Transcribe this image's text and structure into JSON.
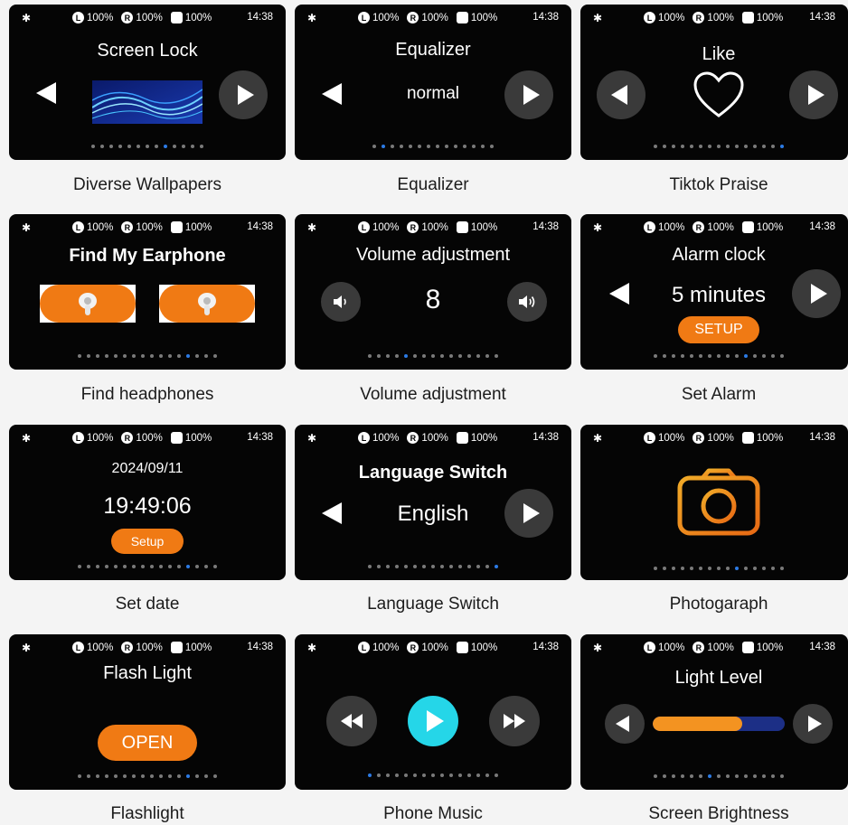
{
  "status_bar": {
    "left_pct": "100%",
    "right_pct": "100%",
    "battery_pct": "100%",
    "time": "14:38",
    "left_label": "L",
    "right_label": "R"
  },
  "cards": {
    "wallpapers": {
      "title": "Screen Lock",
      "caption": "Diverse Wallpapers"
    },
    "equalizer": {
      "title": "Equalizer",
      "value": "normal",
      "caption": "Equalizer"
    },
    "praise": {
      "title": "Like",
      "caption": "Tiktok Praise"
    },
    "find": {
      "title": "Find My Earphone",
      "caption": "Find headphones"
    },
    "volume": {
      "title": "Volume adjustment",
      "value": "8",
      "caption": "Volume adjustment"
    },
    "alarm": {
      "title": "Alarm clock",
      "value": "5 minutes",
      "button": "SETUP",
      "caption": "Set Alarm"
    },
    "date": {
      "date": "2024/09/11",
      "time": "19:49:06",
      "button": "Setup",
      "caption": "Set date"
    },
    "language": {
      "title": "Language Switch",
      "value": "English",
      "caption": "Language Switch"
    },
    "photo": {
      "caption": "Photogaraph"
    },
    "flash": {
      "title": "Flash Light",
      "button": "OPEN",
      "caption": "Flashlight"
    },
    "music": {
      "caption": "Phone Music"
    },
    "brightness": {
      "title": "Light Level",
      "level_fraction": 0.68,
      "caption": "Screen Brightness"
    }
  },
  "colors": {
    "accent_orange": "#f07a14",
    "dot_active": "#2c7be5",
    "play_cyan": "#25d6e8",
    "bar_track": "#1c2f86"
  }
}
